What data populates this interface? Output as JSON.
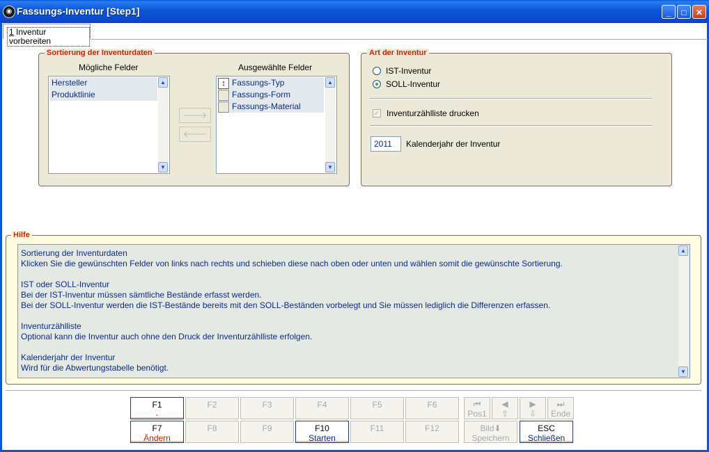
{
  "window": {
    "title": "Fassungs-Inventur [Step1]"
  },
  "tab": {
    "mnemonic": "1",
    "label": " Inventur vorbereiten"
  },
  "sort": {
    "legend": "Sortierung der Inventurdaten",
    "left_header": "Mögliche Felder",
    "right_header": "Ausgewählte Felder",
    "possible": [
      "Hersteller",
      "Produktlinie"
    ],
    "selected": [
      "Fassungs-Typ",
      "Fassungs-Form",
      "Fassungs-Material"
    ],
    "move_right": "🡒",
    "move_left": "🡐"
  },
  "art": {
    "legend": "Art der Inventur",
    "ist_label": "IST-Inventur",
    "soll_label": "SOLL-Inventur",
    "selected": "SOLL-Inventur",
    "print_label": "Inventurzählliste drucken",
    "print_checked": true,
    "year_value": "2011",
    "year_label": "Kalenderjahr der Inventur"
  },
  "help": {
    "legend": "Hilfe",
    "lines": [
      "Sortierung der Inventurdaten",
      "Klicken Sie die gewünschten Felder von links nach rechts und schieben diese nach oben oder unten und wählen somit die gewünschte Sortierung.",
      "",
      "IST oder SOLL-Inventur",
      "Bei der IST-Inventur müssen sämtliche Bestände erfasst werden.",
      "Bei der SOLL-Inventur werden die IST-Bestände bereits mit den SOLL-Beständen vorbelegt und Sie müssen lediglich die Differenzen erfassen.",
      "",
      "Inventurzählliste",
      "Optional kann die Inventur auch ohne den Druck der Inventurzählliste erfolgen.",
      "",
      "Kalenderjahr der Inventur",
      "Wird für die Abwertungstabelle benötigt."
    ]
  },
  "fkeys": {
    "f1": {
      "key": "F1",
      "label": "-"
    },
    "f2": "F2",
    "f3": "F3",
    "f4": "F4",
    "f5": "F5",
    "f6": "F6",
    "f7": {
      "key": "F7",
      "label": "Ändern"
    },
    "f8": "F8",
    "f9": "F9",
    "f10": {
      "key": "F10",
      "label": "Starten"
    },
    "f11": "F11",
    "f12": "F12",
    "pos1": "Pos1",
    "ende": "Ende",
    "bild": "Bild",
    "speichern": "Speichern",
    "esc": {
      "key": "ESC",
      "label": "Schließen"
    }
  }
}
